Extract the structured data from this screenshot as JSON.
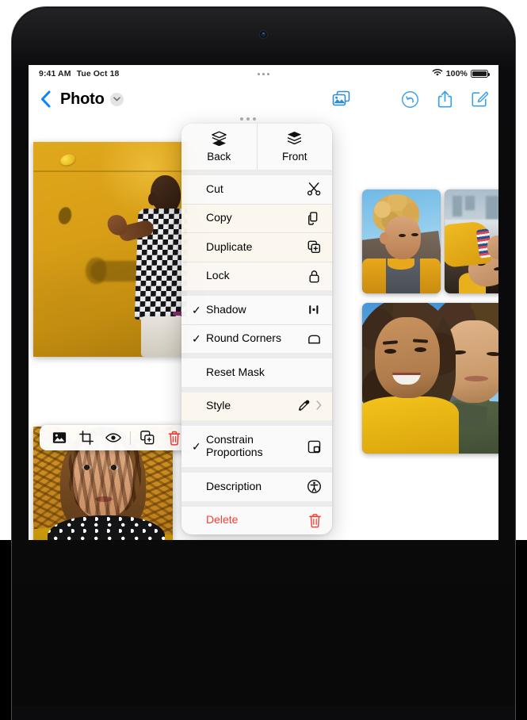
{
  "device": {
    "name": "iPad"
  },
  "status_bar": {
    "time": "9:41 AM",
    "date": "Tue Oct 18",
    "wifi_icon": "wifi-icon",
    "battery_percent": "100%",
    "battery_icon": "battery-full-icon",
    "center_dots_icon": "multitasking-dots-icon"
  },
  "nav_bar": {
    "back_icon": "chevron-left-icon",
    "title": "Photo",
    "title_chevron_icon": "chevron-down-icon",
    "accent_color": "#0a84ff",
    "actions": [
      {
        "name": "insert-media-button",
        "icon": "media-photo-icon"
      },
      {
        "name": "undo-button",
        "icon": "undo-arrow-icon"
      },
      {
        "name": "share-button",
        "icon": "share-up-arrow-icon"
      },
      {
        "name": "compose-button",
        "icon": "compose-pencil-icon"
      }
    ]
  },
  "element_toolbar": {
    "buttons": [
      {
        "name": "replace-image-button",
        "icon": "image-icon"
      },
      {
        "name": "crop-mask-button",
        "icon": "crop-icon"
      },
      {
        "name": "preview-button",
        "icon": "eye-icon"
      },
      {
        "name": "duplicate-button",
        "icon": "duplicate-icon"
      },
      {
        "name": "delete-button",
        "icon": "trash-icon",
        "color": "#ff3b30"
      }
    ]
  },
  "context_menu": {
    "arrange": [
      {
        "label": "Back",
        "icon": "send-to-back-icon"
      },
      {
        "label": "Front",
        "icon": "bring-to-front-icon"
      }
    ],
    "items": [
      {
        "label": "Cut",
        "icon": "scissors-icon",
        "checked": false,
        "destructive": false,
        "submenu": false
      },
      {
        "label": "Copy",
        "icon": "copy-documents-icon",
        "checked": false,
        "destructive": false,
        "submenu": false
      },
      {
        "label": "Duplicate",
        "icon": "duplicate-plus-icon",
        "checked": false,
        "destructive": false,
        "submenu": false
      },
      {
        "label": "Lock",
        "icon": "padlock-icon",
        "checked": false,
        "destructive": false,
        "submenu": false
      },
      {
        "label": "Shadow",
        "icon": "shadow-offset-icon",
        "checked": true,
        "destructive": false,
        "submenu": false
      },
      {
        "label": "Round Corners",
        "icon": "rounded-rectangle-icon",
        "checked": true,
        "destructive": false,
        "submenu": false
      },
      {
        "label": "Reset Mask",
        "icon": null,
        "checked": false,
        "destructive": false,
        "submenu": false
      },
      {
        "label": "Style",
        "icon": "eyedropper-icon",
        "checked": false,
        "destructive": false,
        "submenu": true
      },
      {
        "label": "Constrain Proportions",
        "icon": "constrain-proportions-icon",
        "checked": true,
        "destructive": false,
        "submenu": false
      },
      {
        "label": "Description",
        "icon": "accessibility-icon",
        "checked": false,
        "destructive": false,
        "submenu": false
      },
      {
        "label": "Delete",
        "icon": "trash-icon",
        "checked": false,
        "destructive": true,
        "submenu": false
      }
    ],
    "checkmark_glyph": "✓",
    "destructive_color": "#ff3b30"
  },
  "canvas": {
    "photos": [
      {
        "name": "photo-yellow-wall",
        "description": "Person in black and white checkered shirt tossing a lemon against a yellow wall"
      },
      {
        "name": "photo-hat-portrait",
        "description": "Person wearing a woven straw hat casting dappled shadows on their face"
      },
      {
        "name": "photo-curly-kid",
        "description": "Child with curly blond hair in a yellow and gray raglan shirt"
      },
      {
        "name": "photo-yellow-jacket",
        "description": "Person in a yellow jacket lying down with a city skyline behind"
      },
      {
        "name": "photo-friends-selfie",
        "description": "Two friends smiling in a selfie with mountains and blue sky"
      }
    ]
  }
}
